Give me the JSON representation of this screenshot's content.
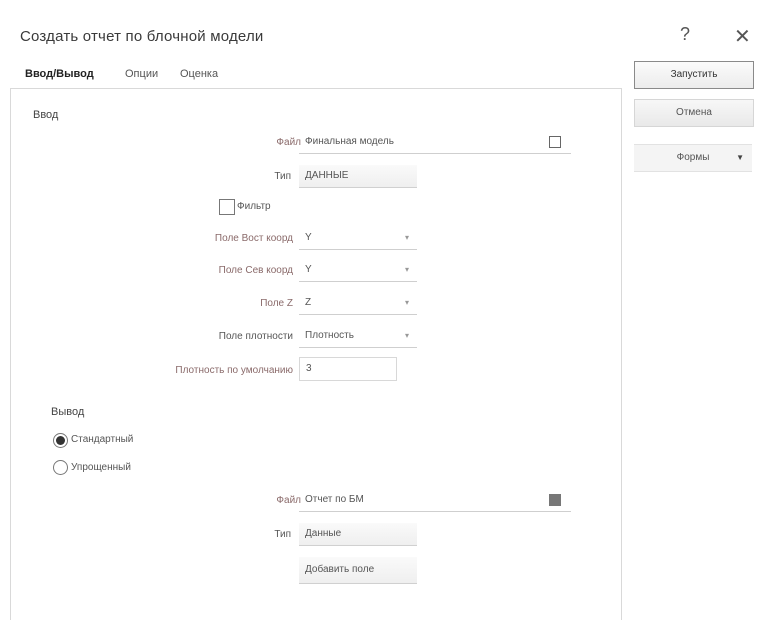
{
  "window": {
    "title": "Создать отчет по блочной модели",
    "help": "?",
    "close": "✕"
  },
  "tabs": [
    {
      "label": "Ввод/Вывод"
    },
    {
      "label": "Опции"
    },
    {
      "label": "Оценка"
    }
  ],
  "side_buttons": {
    "run": "Запустить",
    "cancel": "Отмена",
    "forms": "Формы",
    "forms_arrow": "▼"
  },
  "input": {
    "section": "Ввод",
    "file_label": "Файл",
    "file_value": "Финальная модель",
    "type_label": "Тип",
    "type_value": "ДАННЫЕ",
    "filter_label": "Фильтр",
    "east_label": "Поле Вост коорд",
    "east_value": "Y",
    "north_label": "Поле Сев коорд",
    "north_value": "Y",
    "z_label": "Поле Z",
    "z_value": "Z",
    "density_label": "Поле плотности",
    "density_value": "Плотность",
    "default_density_label": "Плотность по умолчанию",
    "default_density_value": "3"
  },
  "output": {
    "section": "Вывод",
    "standard": "Стандартный",
    "simplified": "Упрощенный",
    "file_label": "Файл",
    "file_value": "Отчет по БМ",
    "type_label": "Тип",
    "type_value": "Данные",
    "add_field": "Добавить поле"
  }
}
